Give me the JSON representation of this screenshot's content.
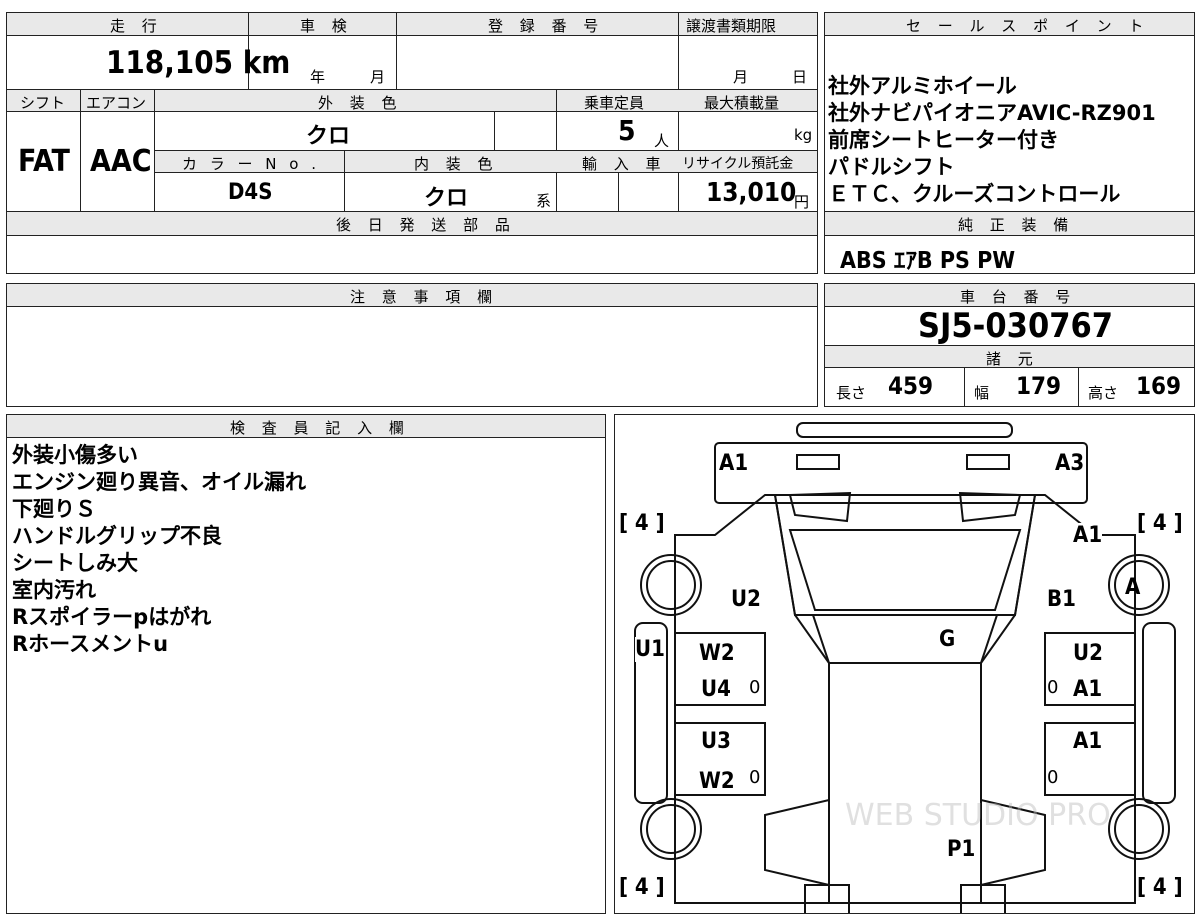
{
  "top_sheet": {
    "mileage_header": "走 行",
    "mileage_value": "118,105 km",
    "inspection_header": "車 検",
    "inspection_year": "年",
    "inspection_month": "月",
    "registration_header": "登 録 番 号",
    "transfer_header": "譲渡書類期限",
    "transfer_month": "月",
    "transfer_day": "日",
    "shift_header": "シフト",
    "shift_value": "FAT",
    "aircon_header": "エアコン",
    "aircon_value": "AAC",
    "exterior_color_header": "外 装 色",
    "exterior_color_value": "クロ",
    "capacity_header": "乗車定員",
    "capacity_value": "5",
    "capacity_unit": "人",
    "max_load_header": "最大積載量",
    "max_load_unit": "kg",
    "color_no_header": "カ ラ ー N o .",
    "color_no_value": "D4S",
    "interior_color_header": "内 装 色",
    "interior_color_value": "クロ",
    "interior_color_suffix": "系",
    "import_header": "輸 入 車",
    "recycle_header": "リサイクル預託金",
    "recycle_value": "13,010",
    "recycle_unit": "円",
    "later_parts_header": "後 日 発 送 部 品"
  },
  "sales_points": {
    "header": "セ ー ル ス ポ イ ン ト",
    "items": [
      "社外アルミホイール",
      "社外ナビパイオニアAVIC-RZ901",
      "前席シートヒーター付き",
      "パドルシフト",
      "ＥＴＣ、クルーズコントロール"
    ]
  },
  "standard_equipment": {
    "header": "純 正 装 備",
    "value": "ABS ｴｱB PS PW"
  },
  "notes": {
    "header": "注 意 事 項 欄"
  },
  "chassis": {
    "header": "車 台 番 号",
    "value": "SJ5-030767"
  },
  "specs": {
    "header": "諸 元",
    "length_label": "長さ",
    "length_value": "459",
    "width_label": "幅",
    "width_value": "179",
    "height_label": "高さ",
    "height_value": "169"
  },
  "inspector": {
    "header": "検 査 員 記 入 欄",
    "lines": [
      "外装小傷多い",
      "エンジン廻り異音、オイル漏れ",
      "下廻りＳ",
      "ハンドルグリップ不良",
      "シートしみ大",
      "室内汚れ",
      "Rスポイラーpはがれ",
      "Rホースメントu"
    ]
  },
  "car_diagram": {
    "watermark": "WEB STUDIO PRO",
    "marks": {
      "front_left": "A1",
      "front_right": "A3",
      "tire_fl": "[ 4 ]",
      "tire_fr": "[ 4 ]",
      "tire_rl": "[ 4 ]",
      "tire_rr": "[ 4 ]",
      "fender_right": "A1",
      "hood_left": "U2",
      "fender_right_b": "B1",
      "wheel_right": "A",
      "pillar_left": "U1",
      "windshield": "G",
      "door_l1_top": "W2",
      "door_l1_bottom": "U4",
      "door_r1_top": "U2",
      "door_r1_bottom": "A1",
      "door_l2_top": "U3",
      "door_l2_bottom": "W2",
      "door_r2_top": "A1",
      "rear": "P1",
      "zero_1": "0",
      "zero_2": "0",
      "zero_3": "0",
      "zero_4": "0"
    }
  }
}
